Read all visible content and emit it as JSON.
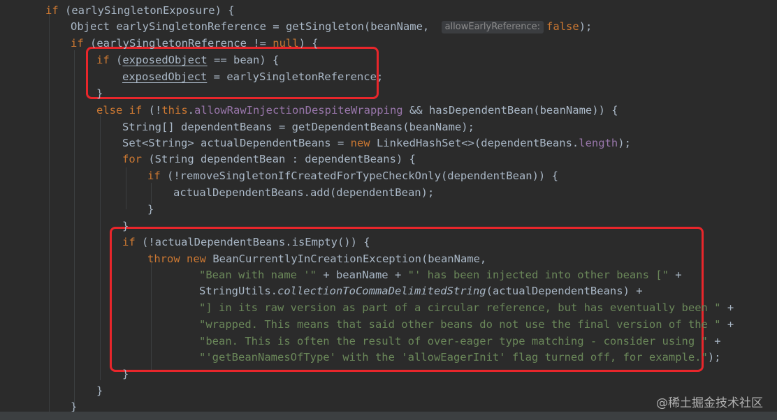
{
  "editor": {
    "lines": [
      {
        "segments": [
          {
            "t": "if",
            "c": "kw"
          },
          {
            "t": " (earlySingletonExposure) {",
            "c": "plain"
          }
        ]
      },
      {
        "segments": [
          {
            "t": "Object earlySingletonReference = getSingleton(beanName, ",
            "c": "plain"
          },
          {
            "t": "allowEarlyReference:",
            "c": "hint"
          },
          {
            "t": "false",
            "c": "kw"
          },
          {
            "t": ");",
            "c": "plain"
          }
        ]
      },
      {
        "segments": [
          {
            "t": "if",
            "c": "kw"
          },
          {
            "t": " (earlySingletonReference != ",
            "c": "plain"
          },
          {
            "t": "null",
            "c": "kw"
          },
          {
            "t": ") {",
            "c": "plain"
          }
        ]
      },
      {
        "segments": [
          {
            "t": "if",
            "c": "kw"
          },
          {
            "t": " (",
            "c": "plain"
          },
          {
            "t": "exposedObject",
            "c": "plain ul"
          },
          {
            "t": " == bean) {",
            "c": "plain"
          }
        ]
      },
      {
        "segments": [
          {
            "t": "exposedObject",
            "c": "plain ul"
          },
          {
            "t": " = earlySingletonReference;",
            "c": "plain"
          }
        ]
      },
      {
        "segments": [
          {
            "t": "}",
            "c": "plain"
          }
        ]
      },
      {
        "segments": [
          {
            "t": "else if",
            "c": "kw"
          },
          {
            "t": " (!",
            "c": "plain"
          },
          {
            "t": "this",
            "c": "kw"
          },
          {
            "t": ".",
            "c": "plain"
          },
          {
            "t": "allowRawInjectionDespiteWrapping",
            "c": "fld"
          },
          {
            "t": " && hasDependentBean(beanName)) {",
            "c": "plain"
          }
        ]
      },
      {
        "segments": [
          {
            "t": "String[] dependentBeans = getDependentBeans(beanName);",
            "c": "plain"
          }
        ]
      },
      {
        "segments": [
          {
            "t": "Set<String> actualDependentBeans = ",
            "c": "plain"
          },
          {
            "t": "new",
            "c": "kw"
          },
          {
            "t": " LinkedHashSet<>(dependentBeans.",
            "c": "plain"
          },
          {
            "t": "length",
            "c": "fld"
          },
          {
            "t": ");",
            "c": "plain"
          }
        ]
      },
      {
        "segments": [
          {
            "t": "for",
            "c": "kw"
          },
          {
            "t": " (String dependentBean : dependentBeans) {",
            "c": "plain"
          }
        ]
      },
      {
        "segments": [
          {
            "t": "if",
            "c": "kw"
          },
          {
            "t": " (!removeSingletonIfCreatedForTypeCheckOnly(dependentBean)) {",
            "c": "plain"
          }
        ]
      },
      {
        "segments": [
          {
            "t": "actualDependentBeans.add(dependentBean);",
            "c": "plain"
          }
        ]
      },
      {
        "segments": [
          {
            "t": "}",
            "c": "plain"
          }
        ]
      },
      {
        "segments": [
          {
            "t": "}",
            "c": "plain"
          }
        ]
      },
      {
        "segments": [
          {
            "t": "if",
            "c": "kw"
          },
          {
            "t": " (!actualDependentBeans.isEmpty()) {",
            "c": "plain"
          }
        ]
      },
      {
        "segments": [
          {
            "t": "throw new",
            "c": "kw"
          },
          {
            "t": " BeanCurrentlyInCreationException(beanName,",
            "c": "plain"
          }
        ]
      },
      {
        "segments": [
          {
            "t": "\"Bean with name '\"",
            "c": "str"
          },
          {
            "t": " + beanName + ",
            "c": "plain"
          },
          {
            "t": "\"' has been injected into other beans [\"",
            "c": "str"
          },
          {
            "t": " +",
            "c": "plain"
          }
        ]
      },
      {
        "segments": [
          {
            "t": "StringUtils.",
            "c": "plain"
          },
          {
            "t": "collectionToCommaDelimitedString",
            "c": "plain it"
          },
          {
            "t": "(actualDependentBeans) +",
            "c": "plain"
          }
        ]
      },
      {
        "segments": [
          {
            "t": "\"] in its raw version as part of a circular reference, but has eventually been \"",
            "c": "str"
          },
          {
            "t": " +",
            "c": "plain"
          }
        ]
      },
      {
        "segments": [
          {
            "t": "\"wrapped. This means that said other beans do not use the final version of the \"",
            "c": "str"
          },
          {
            "t": " +",
            "c": "plain"
          }
        ]
      },
      {
        "segments": [
          {
            "t": "\"bean. This is often the result of over-eager type matching - consider using \"",
            "c": "str"
          },
          {
            "t": " +",
            "c": "plain"
          }
        ]
      },
      {
        "segments": [
          {
            "t": "\"'getBeanNamesOfType' with the 'allowEagerInit' flag turned off, for example.\"",
            "c": "str"
          },
          {
            "t": ");",
            "c": "plain"
          }
        ]
      },
      {
        "segments": [
          {
            "t": "}",
            "c": "plain"
          }
        ]
      },
      {
        "segments": [
          {
            "t": "}",
            "c": "plain"
          }
        ]
      },
      {
        "segments": [
          {
            "t": "}",
            "c": "plain"
          }
        ]
      }
    ]
  },
  "highlight_color": "#e8262b",
  "watermark": "@稀土掘金技术社区"
}
